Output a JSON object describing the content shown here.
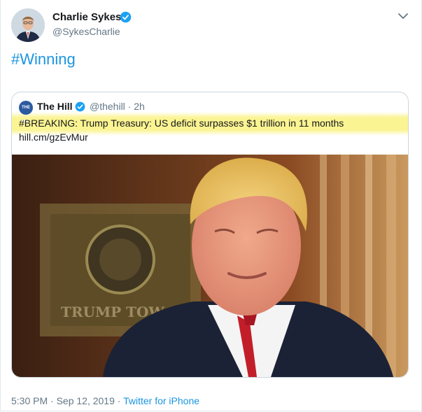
{
  "tweet": {
    "author_name": "Charlie Sykes",
    "author_handle": "@SykesCharlie",
    "text": "#Winning",
    "timestamp": "5:30 PM · Sep 12, 2019 ·",
    "source": "Twitter for iPhone"
  },
  "quoted": {
    "avatar_text": "THE HILL",
    "name": "The Hill",
    "handle_time": "@thehill · 2h",
    "text": "#BREAKING: Trump Treasury: US deficit surpasses $1 trillion in 11 months",
    "link": "hill.cm/gzEvMur",
    "media_sign": "TRUMP TOW"
  },
  "colors": {
    "link": "#1b95e0",
    "verified": "#1da1f2",
    "highlight": "#f6ec6e"
  },
  "icons": [
    "verified-badge-icon",
    "chevron-down-icon"
  ]
}
